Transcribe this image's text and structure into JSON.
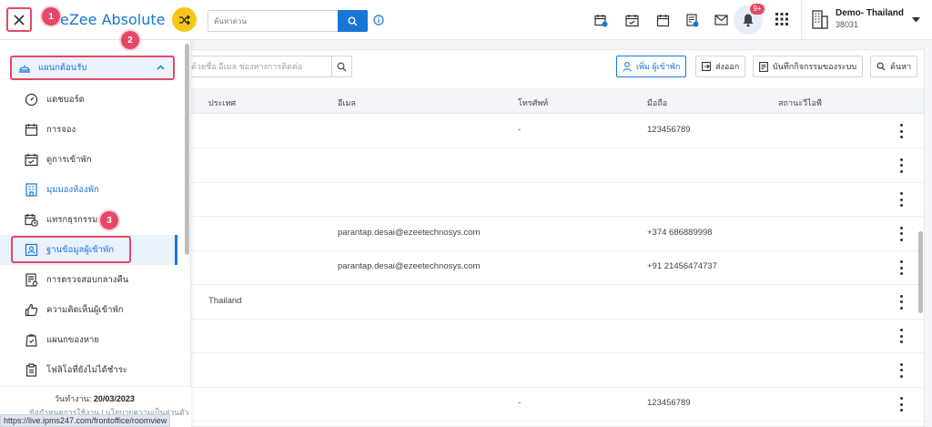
{
  "header": {
    "app_name": "eZee Absolute",
    "search_placeholder": "ค้นหาด่วน",
    "notification_count": "9+",
    "property_name": "Demo- Thailand",
    "property_id": "38031"
  },
  "sidebar": {
    "section_label": "แผนกต้อนรับ",
    "items": [
      {
        "label": "แดชบอร์ด",
        "icon": "dashboard-gauge-icon"
      },
      {
        "label": "การจอง",
        "icon": "calendar-icon"
      },
      {
        "label": "ดูการเข้าพัก",
        "icon": "calendar-check-icon"
      },
      {
        "label": "มุมมองห้องพัก",
        "icon": "room-view-icon"
      },
      {
        "label": "แทรกธุรกรรม",
        "icon": "calendar-clock-icon"
      },
      {
        "label": "ฐานข้อมูลผู้เข้าพัก",
        "icon": "guest-database-icon"
      },
      {
        "label": "การตรวจสอบกลางคืน",
        "icon": "night-audit-icon"
      },
      {
        "label": "ความคิดเห็นผู้เข้าพัก",
        "icon": "thumbs-up-icon"
      },
      {
        "label": "แผนกของหาย",
        "icon": "lost-found-icon"
      },
      {
        "label": "โฟลิโอที่ยังไม่ได้ชำระ",
        "icon": "clipboard-icon"
      }
    ],
    "workday_label": "วันทำงาน:",
    "workday_value": "20/03/2023",
    "footer_links": "ข้อกำหนดการใช้งาน | นโยบายความเป็นส่วนตัว"
  },
  "toolbar": {
    "filter_placeholder": "ด้วยชื่อ อีเมล ช่องทางการติดต่อ",
    "add_guest": "เพิ่ม ผู้เข้าพัก",
    "export": "ส่งออก",
    "audit_log": "บันทึกกิจกรรมของระบบ",
    "search": "ค้นหา"
  },
  "table": {
    "columns": [
      "ประเทศ",
      "อีเมล",
      "โทรศัพท์",
      "มือถือ",
      "สถานะวีไอพี"
    ],
    "rows": [
      {
        "country": "",
        "email": "",
        "phone": "-",
        "mobile": "123456789",
        "vip": ""
      },
      {
        "country": "",
        "email": "",
        "phone": "",
        "mobile": "",
        "vip": ""
      },
      {
        "country": "",
        "email": "",
        "phone": "",
        "mobile": "",
        "vip": ""
      },
      {
        "country": "",
        "email": "parantap.desai@ezeetechnosys.com",
        "phone": "",
        "mobile": "+374 686889998",
        "vip": ""
      },
      {
        "country": "",
        "email": "parantap.desai@ezeetechnosys.com",
        "phone": "",
        "mobile": "+91 21456474737",
        "vip": ""
      },
      {
        "country": "Thailand",
        "email": "",
        "phone": "",
        "mobile": "",
        "vip": ""
      },
      {
        "country": "",
        "email": "",
        "phone": "",
        "mobile": "",
        "vip": ""
      },
      {
        "country": "",
        "email": "",
        "phone": "",
        "mobile": "",
        "vip": ""
      },
      {
        "country": "",
        "email": "",
        "phone": "-",
        "mobile": "123456789",
        "vip": ""
      }
    ]
  },
  "annotations": [
    "1",
    "2",
    "3"
  ],
  "statusbar": {
    "url": "https://live.ipms247.com/frontoffice/roomview"
  },
  "colors": {
    "brand_blue": "#1877d6",
    "highlight_red": "#e54866",
    "shuffle_yellow": "#f5c518"
  }
}
